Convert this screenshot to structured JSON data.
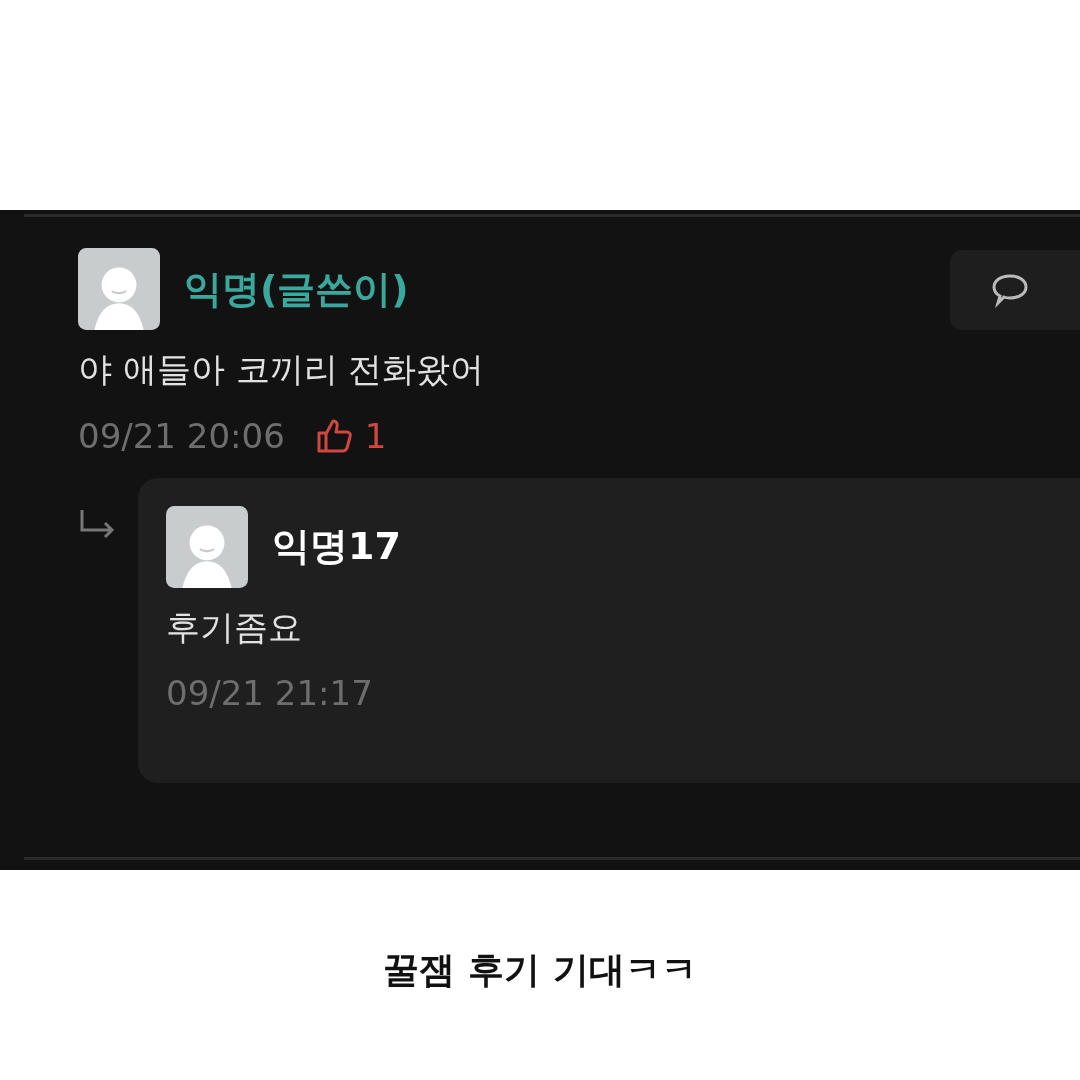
{
  "comment": {
    "author": "익명(글쓴이)",
    "is_writer": true,
    "text": "야 애들아 코끼리 전화왔어",
    "time": "09/21 20:06",
    "likes": "1"
  },
  "reply": {
    "author": "익명17",
    "is_writer": false,
    "text": "후기좀요",
    "time": "09/21 21:17"
  },
  "caption": "꿀잼 후기 기대ㅋㅋ"
}
